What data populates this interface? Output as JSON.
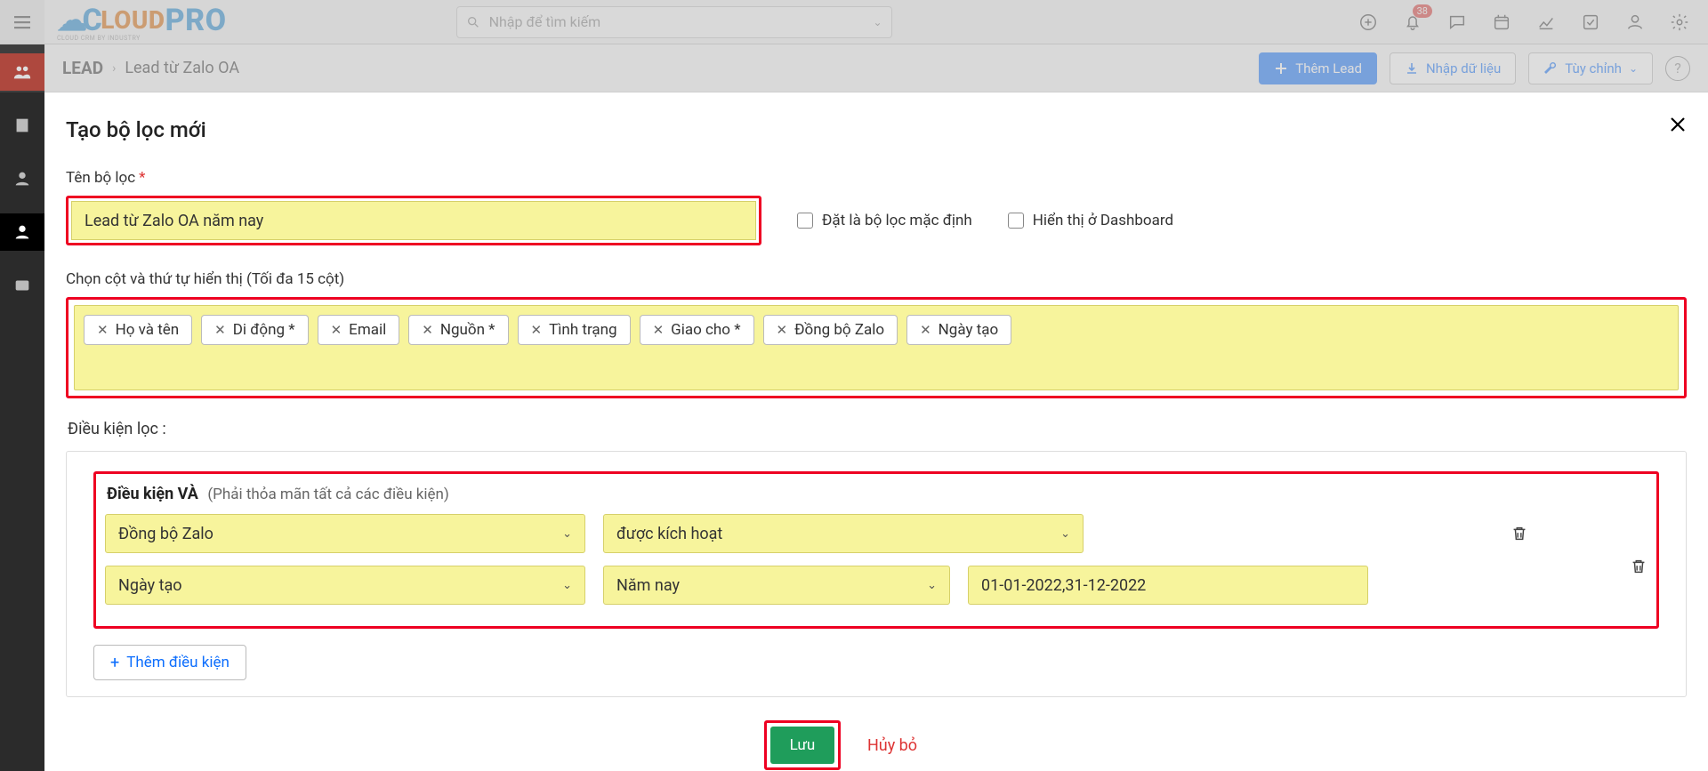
{
  "topbar": {
    "search_placeholder": "Nhập để tìm kiếm",
    "notif_badge": "38"
  },
  "breadcrumb": {
    "root": "LEAD",
    "current": "Lead từ Zalo OA"
  },
  "subheader": {
    "add_lead": "Thêm Lead",
    "import": "Nhập dữ liệu",
    "customize": "Tùy chỉnh"
  },
  "panel": {
    "title": "Tạo bộ lọc mới",
    "field_name_label": "Tên bộ lọc",
    "filter_name_value": "Lead từ Zalo OA năm nay",
    "chk_default": "Đặt là bộ lọc mặc định",
    "chk_dashboard": "Hiển thị ở Dashboard",
    "columns_label": "Chọn cột và thứ tự hiển thị (Tối đa 15 cột)",
    "columns": [
      "Họ và tên",
      "Di động *",
      "Email",
      "Nguồn *",
      "Tình trạng",
      "Giao cho *",
      "Đồng bộ Zalo",
      "Ngày tạo"
    ],
    "conditions_label": "Điều kiện lọc :",
    "cond_and_title": "Điều kiện VÀ",
    "cond_and_sub": "(Phải thỏa mãn tất cả các điều kiện)",
    "rows": [
      {
        "field": "Đồng bộ Zalo",
        "op": "được kích hoạt",
        "val": ""
      },
      {
        "field": "Ngày tạo",
        "op": "Năm nay",
        "val": "01-01-2022,31-12-2022"
      }
    ],
    "add_condition": "Thêm điều kiện",
    "save": "Lưu",
    "cancel": "Hủy bỏ"
  }
}
